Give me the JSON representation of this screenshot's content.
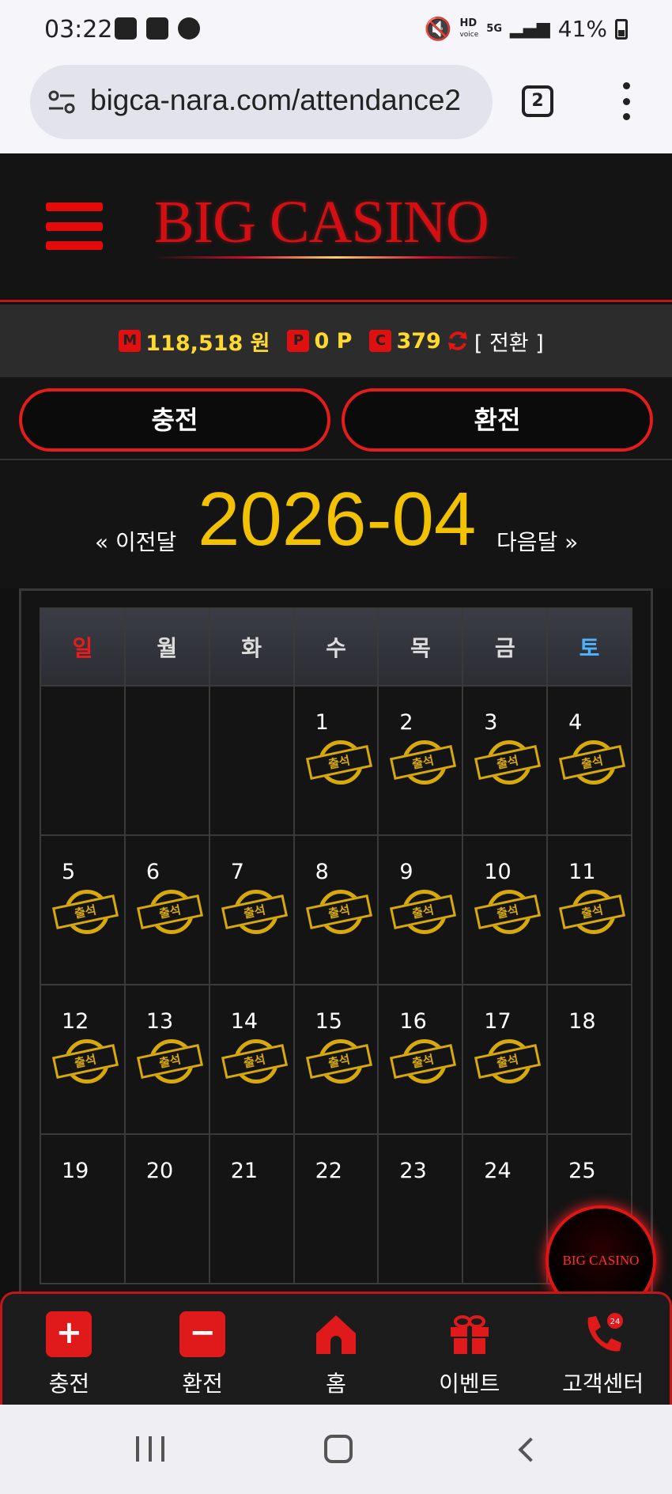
{
  "status_bar": {
    "time": "03:22",
    "hd_label": "HD",
    "voice_label": "voice",
    "network": "5G",
    "battery": "41%"
  },
  "browser": {
    "url": "bigca-nara.com/attendance2",
    "tab_count": "2"
  },
  "header": {
    "logo": "BIG CASINO"
  },
  "balance": {
    "money_badge": "M",
    "money": "118,518 원",
    "point_badge": "P",
    "points": "0 P",
    "coin_badge": "C",
    "coins": "379",
    "convert_label": "[ 전환 ]"
  },
  "actions": {
    "charge": "충전",
    "exchange": "환전"
  },
  "calendar": {
    "prev_label": "« 이전달",
    "next_label": "다음달 »",
    "month": "2026-04",
    "weekdays": [
      "일",
      "월",
      "화",
      "수",
      "목",
      "금",
      "토"
    ],
    "stamp_label": "출석",
    "weeks": [
      [
        "",
        "",
        "",
        "1",
        "2",
        "3",
        "4"
      ],
      [
        "5",
        "6",
        "7",
        "8",
        "9",
        "10",
        "11"
      ],
      [
        "12",
        "13",
        "14",
        "15",
        "16",
        "17",
        "18"
      ],
      [
        "19",
        "20",
        "21",
        "22",
        "23",
        "24",
        "25"
      ]
    ],
    "attended_days": [
      1,
      2,
      3,
      4,
      5,
      6,
      7,
      8,
      9,
      10,
      11,
      12,
      13,
      14,
      15,
      16,
      17
    ]
  },
  "floating_logo": "BIG CASINO",
  "bottom_nav": {
    "items": [
      {
        "label": "충전",
        "icon": "plus-icon"
      },
      {
        "label": "환전",
        "icon": "minus-icon"
      },
      {
        "label": "홈",
        "icon": "home-icon"
      },
      {
        "label": "이벤트",
        "icon": "gift-icon"
      },
      {
        "label": "고객센터",
        "icon": "phone-24-icon"
      }
    ]
  },
  "colors": {
    "accent_red": "#e01a1a",
    "gold": "#f2c200",
    "balance_yellow": "#ffd92e",
    "sunday_red": "#e81c1c",
    "saturday_blue": "#4fb3ff"
  }
}
